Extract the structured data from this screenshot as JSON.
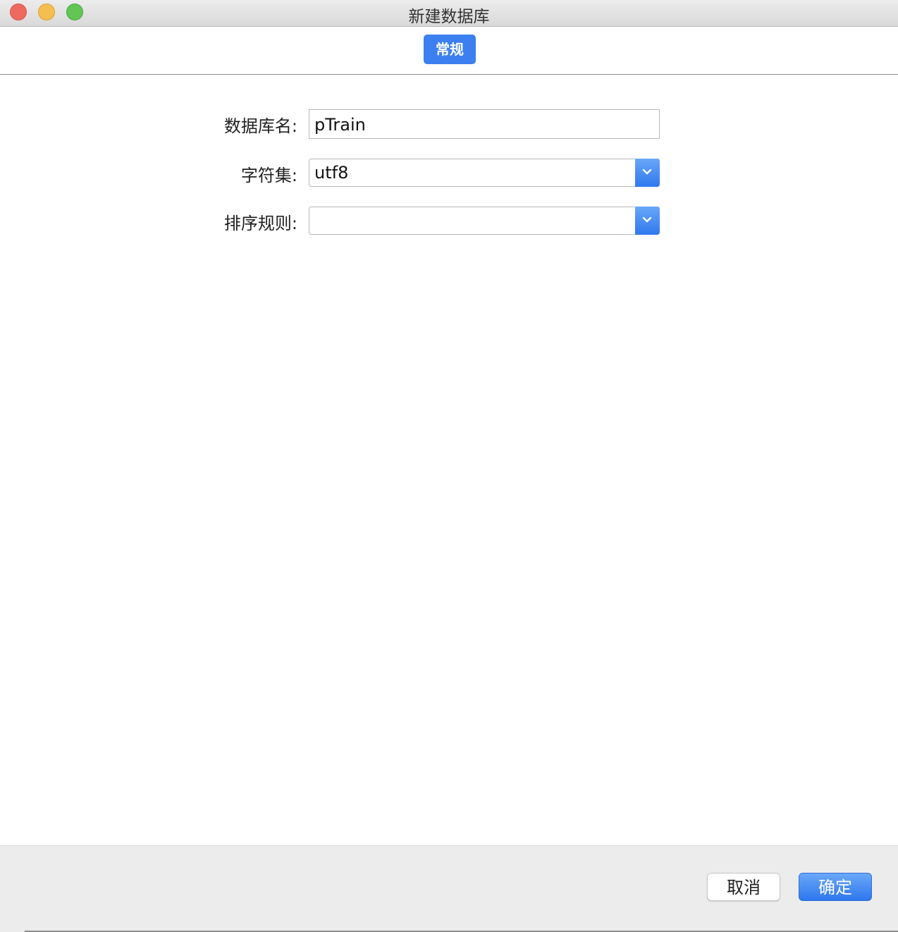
{
  "window": {
    "title": "新建数据库"
  },
  "tabs": [
    {
      "label": "常规",
      "active": true
    }
  ],
  "form": {
    "database_name": {
      "label": "数据库名:",
      "value": "pTrain"
    },
    "charset": {
      "label": "字符集:",
      "value": "utf8"
    },
    "collation": {
      "label": "排序规则:",
      "value": ""
    }
  },
  "footer": {
    "cancel_label": "取消",
    "ok_label": "确定"
  },
  "colors": {
    "accent": "#3c7ff0",
    "close": "#ee6a5f",
    "minimize": "#f5bf4f",
    "maximize": "#62c554"
  },
  "icons": {
    "dropdown": "chevron-down-icon"
  }
}
